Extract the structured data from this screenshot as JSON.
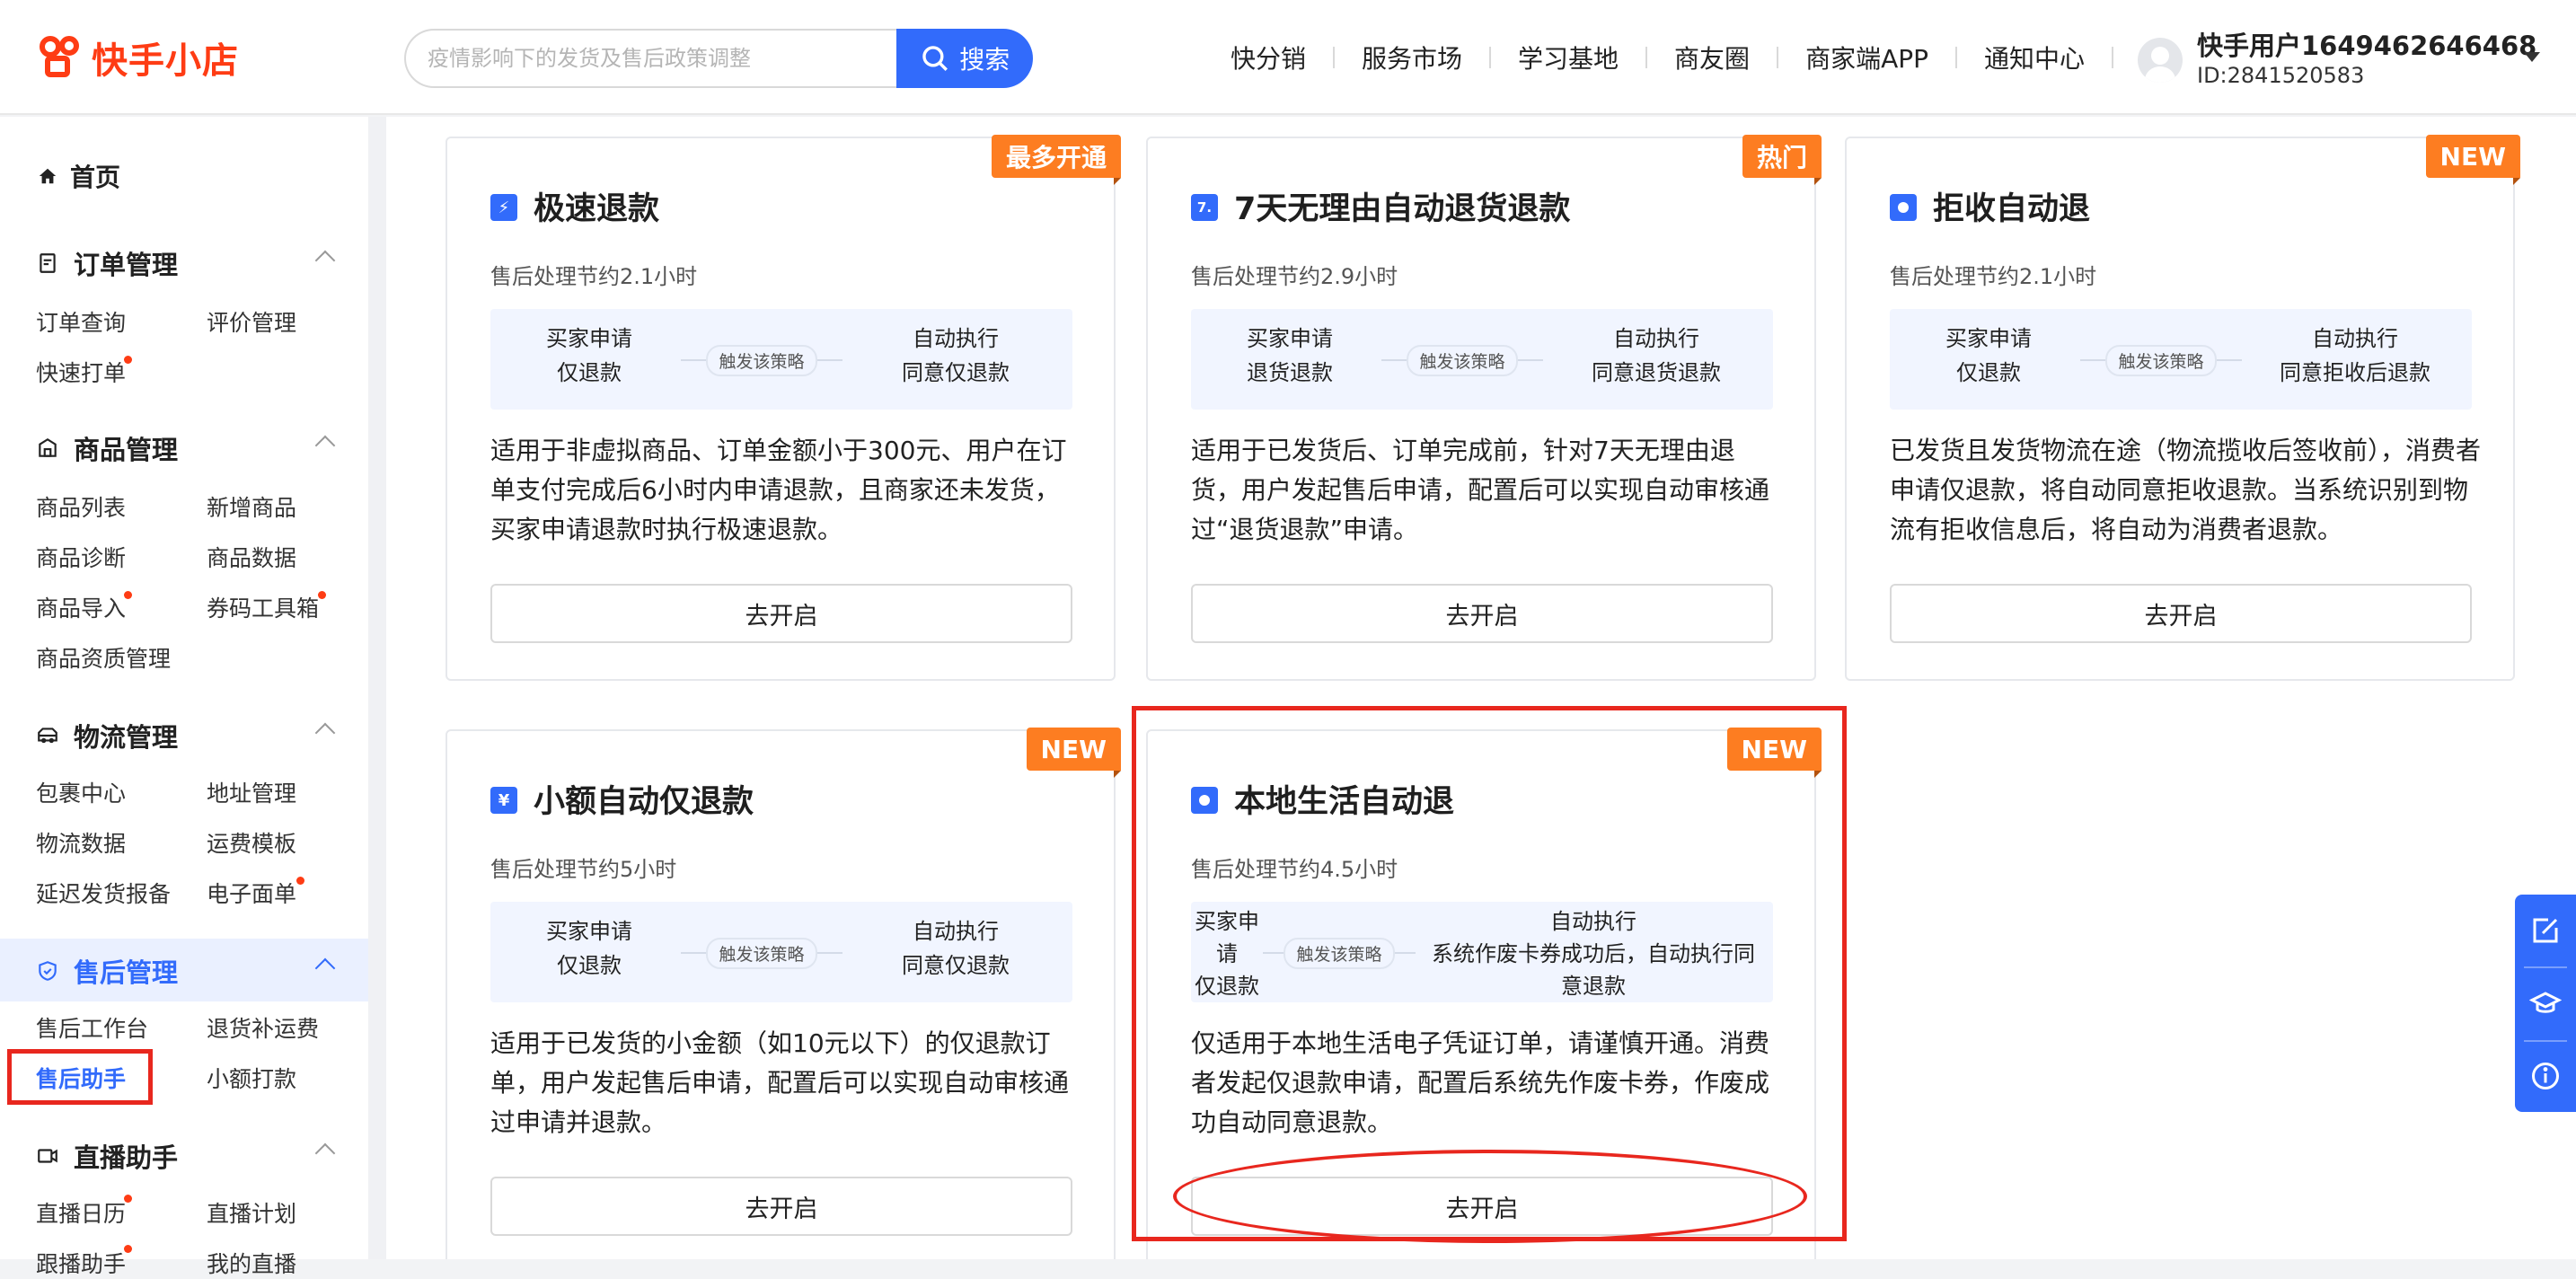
{
  "header": {
    "logo_text": "快手小店",
    "search": {
      "placeholder": "疫情影响下的发货及售后政策调整",
      "button_label": "搜索"
    },
    "nav": [
      "快分销",
      "服务市场",
      "学习基地",
      "商友圈",
      "商家端APP",
      "通知中心"
    ],
    "user": {
      "name": "快手用户1649462646468",
      "id": "ID:2841520583"
    }
  },
  "sidebar": {
    "home": "首页",
    "groups": [
      {
        "title": "订单管理",
        "icon": "order-icon",
        "links": [
          "订单查询",
          "评价管理",
          "快速打单"
        ]
      },
      {
        "title": "商品管理",
        "icon": "goods-icon",
        "links": [
          "商品列表",
          "新增商品",
          "商品诊断",
          "商品数据",
          "商品导入",
          "券码工具箱",
          "商品资质管理"
        ]
      },
      {
        "title": "物流管理",
        "icon": "truck-icon",
        "links": [
          "包裹中心",
          "地址管理",
          "物流数据",
          "运费模板",
          "延迟发货报备",
          "电子面单"
        ]
      },
      {
        "title": "售后管理",
        "icon": "shield-icon",
        "links": [
          "售后工作台",
          "退货补运费",
          "售后助手",
          "小额打款"
        ]
      },
      {
        "title": "直播助手",
        "icon": "live-icon",
        "links": [
          "直播日历",
          "直播计划",
          "跟播助手",
          "我的直播"
        ]
      }
    ],
    "current_link": "售后助手",
    "accent_color": "#326bfb",
    "dot_color": "#fe3c14"
  },
  "cards": [
    {
      "badge": "最多开通",
      "icon_glyph": "⚡",
      "icon_name": "lightning-icon",
      "title": "极速退款",
      "subtitle": "售后处理节约2.1小时",
      "flow": {
        "left": [
          "买家申请",
          "仅退款"
        ],
        "middle": "触发该策略",
        "right": [
          "自动执行",
          "同意仅退款"
        ]
      },
      "description": "适用于非虚拟商品、订单金额小于300元、用户在订单支付完成后6小时内申请退款，且商家还未发货，买家申请退款时执行极速退款。",
      "button": "去开启"
    },
    {
      "badge": "热门",
      "icon_glyph": "7.",
      "icon_name": "seven-day-icon",
      "title": "7天无理由自动退货退款",
      "subtitle": "售后处理节约2.9小时",
      "flow": {
        "left": [
          "买家申请",
          "退货退款"
        ],
        "middle": "触发该策略",
        "right": [
          "自动执行",
          "同意退货退款"
        ]
      },
      "description": "适用于已发货后、订单完成前，针对7天无理由退货，用户发起售后申请，配置后可以实现自动审核通过“退货退款”申请。",
      "button": "去开启"
    },
    {
      "badge": "NEW",
      "icon_glyph": "●",
      "icon_name": "reject-icon",
      "title": "拒收自动退",
      "subtitle": "售后处理节约2.1小时",
      "flow": {
        "left": [
          "买家申请",
          "仅退款"
        ],
        "middle": "触发该策略",
        "right": [
          "自动执行",
          "同意拒收后退款"
        ]
      },
      "description": "已发货且发货物流在途（物流揽收后签收前），消费者申请仅退款，将自动同意拒收退款。当系统识别到物流有拒收信息后，将自动为消费者退款。",
      "button": "去开启"
    },
    {
      "badge": "NEW",
      "icon_glyph": "¥",
      "icon_name": "yen-icon",
      "title": "小额自动仅退款",
      "subtitle": "售后处理节约5小时",
      "flow": {
        "left": [
          "买家申请",
          "仅退款"
        ],
        "middle": "触发该策略",
        "right": [
          "自动执行",
          "同意仅退款"
        ]
      },
      "description": "适用于已发货的小金额（如10元以下）的仅退款订单，用户发起售后申请，配置后可以实现自动审核通过申请并退款。",
      "button": "去开启"
    },
    {
      "badge": "NEW",
      "icon_glyph": "●",
      "icon_name": "local-life-icon",
      "title": "本地生活自动退",
      "subtitle": "售后处理节约4.5小时",
      "flow": {
        "left": [
          "买家申",
          "请",
          "仅退款"
        ],
        "middle": "触发该策略",
        "right": [
          "自动执行",
          "系统作废卡券成功后，自动执行同",
          "意退款"
        ]
      },
      "description": "仅适用于本地生活电子凭证订单，请谨慎开通。消费者发起仅退款申请，配置后系统先作废卡券，作废成功自动同意退款。",
      "button": "去开启"
    }
  ],
  "float_tools": [
    "edit-icon",
    "graduation-cap-icon",
    "info-icon"
  ],
  "colors": {
    "brand": "#fe3c14",
    "primary": "#326bfb",
    "badge": "#fd7d21",
    "annotation": "#e8271e"
  }
}
